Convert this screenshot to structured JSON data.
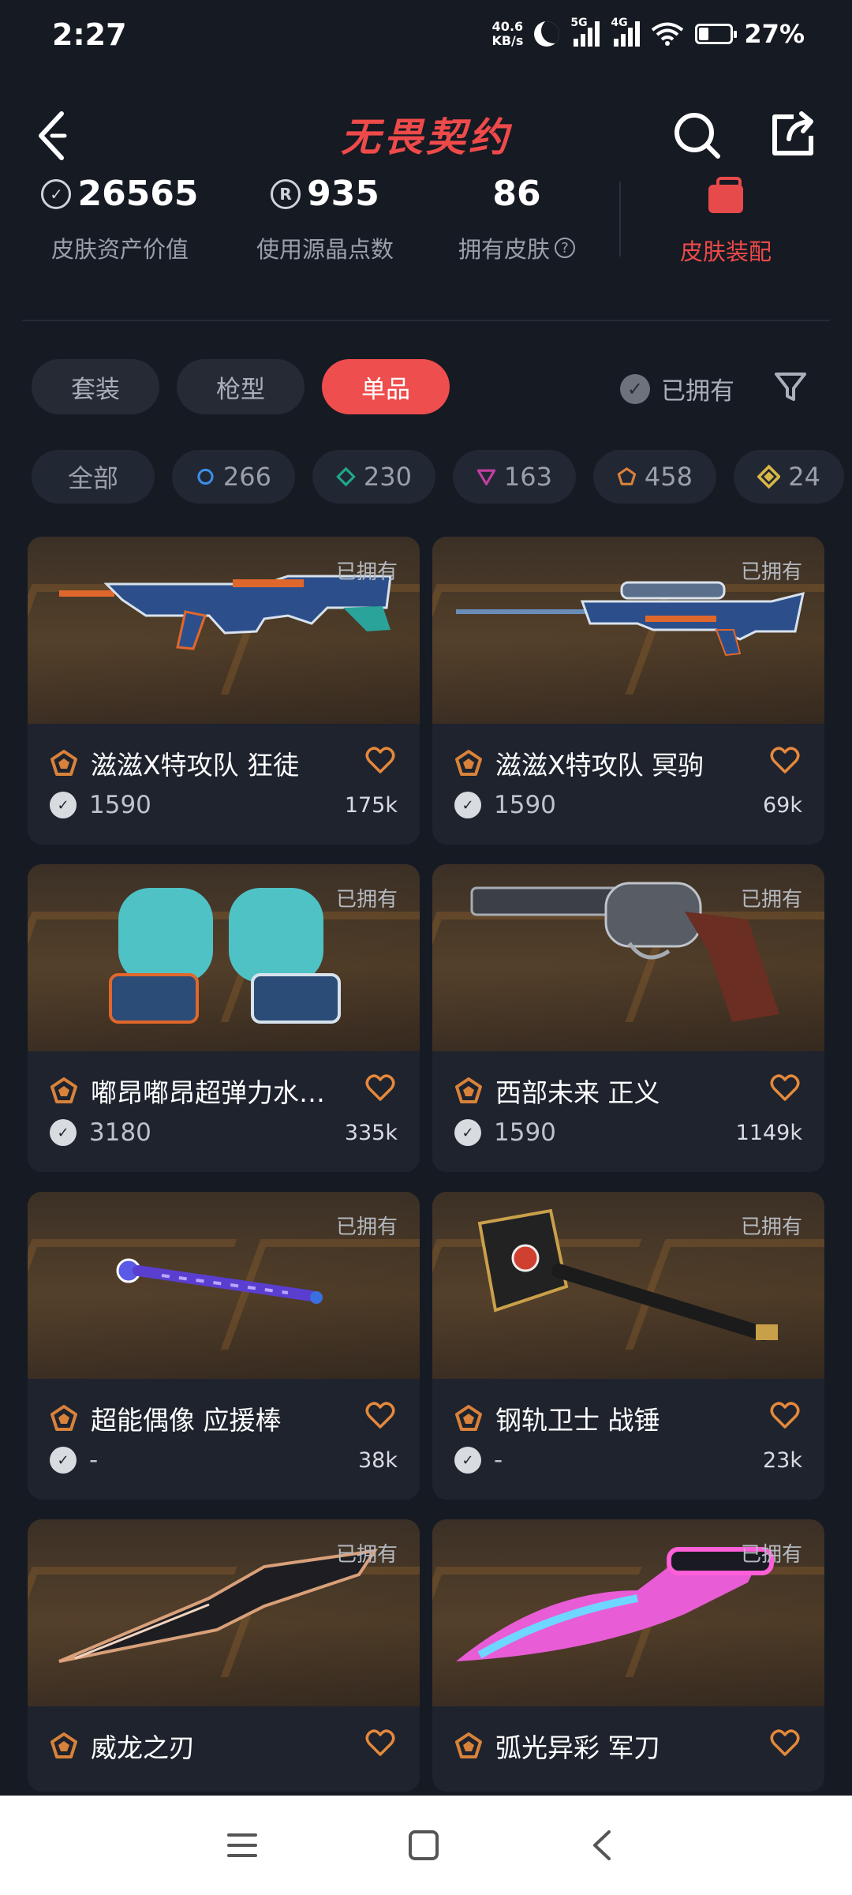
{
  "status_bar": {
    "time": "2:27",
    "net_speed_value": "40.6",
    "net_speed_unit": "KB/s",
    "sig1_label": "5G",
    "sig2_label": "4G",
    "battery": "27%"
  },
  "header": {
    "title": "无畏契约"
  },
  "stats": {
    "asset_value": "26565",
    "asset_label": "皮肤资产价值",
    "rp_value": "935",
    "rp_label": "使用源晶点数",
    "skins_value": "86",
    "skins_label": "拥有皮肤",
    "equip_label": "皮肤装配"
  },
  "tabs": [
    {
      "label": "套装"
    },
    {
      "label": "枪型"
    },
    {
      "label": "单品",
      "active": true
    }
  ],
  "owned_filter": {
    "label": "已拥有"
  },
  "tier_chips": [
    {
      "label": "全部"
    },
    {
      "count": "266",
      "icon": "select-tier-icon",
      "color": "#3b8ee6"
    },
    {
      "count": "230",
      "icon": "deluxe-tier-icon",
      "color": "#1fa88a"
    },
    {
      "count": "163",
      "icon": "premium-tier-icon",
      "color": "#c23fa0"
    },
    {
      "count": "458",
      "icon": "exclusive-tier-icon",
      "color": "#d9823a"
    },
    {
      "count": "24",
      "icon": "ultra-tier-icon",
      "color": "#d8b746"
    }
  ],
  "items": [
    {
      "name": "滋滋X特攻队 狂徒",
      "price": "1590",
      "likes": "175k",
      "owned": "已拥有"
    },
    {
      "name": "滋滋X特攻队 冥驹",
      "price": "1590",
      "likes": "69k",
      "owned": "已拥有"
    },
    {
      "name": "嘟昂嘟昂超弹力水…",
      "price": "3180",
      "likes": "335k",
      "owned": "已拥有"
    },
    {
      "name": "西部未来 正义",
      "price": "1590",
      "likes": "1149k",
      "owned": "已拥有"
    },
    {
      "name": "超能偶像 应援棒",
      "price": "-",
      "likes": "38k",
      "owned": "已拥有"
    },
    {
      "name": "钢轨卫士 战锤",
      "price": "-",
      "likes": "23k",
      "owned": "已拥有"
    },
    {
      "name": "威龙之刃",
      "price": "",
      "likes": "",
      "owned": "已拥有"
    },
    {
      "name": "弧光异彩 军刀",
      "price": "",
      "likes": "",
      "owned": "已拥有"
    }
  ],
  "colors": {
    "accent": "#ef4e4e",
    "background": "#161a23",
    "card": "#1e232e",
    "tier_exclusive": "#d9823a"
  }
}
